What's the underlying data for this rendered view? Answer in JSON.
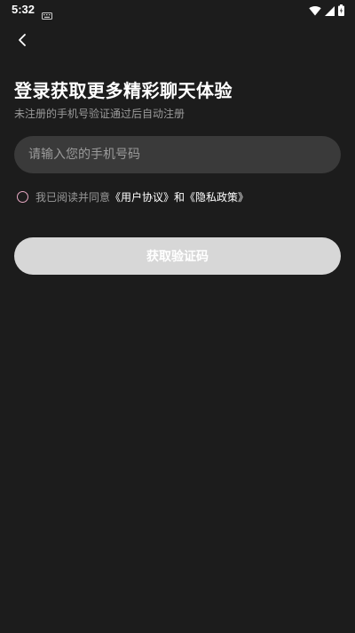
{
  "status_bar": {
    "time": "5:32",
    "icons": [
      "keyboard-icon",
      "wifi-icon",
      "signal-icon",
      "battery-icon"
    ]
  },
  "header": {
    "back_icon": "chevron-left-icon"
  },
  "login": {
    "title": "登录获取更多精彩聊天体验",
    "subtitle": "未注册的手机号验证通过后自动注册",
    "phone_placeholder": "请输入您的手机号码",
    "agreement": {
      "prefix": "我已阅读并同意",
      "user_agreement": "《用户协议》",
      "and": "和",
      "privacy_policy": "《隐私政策》",
      "checked": false
    },
    "get_code_label": "获取验证码"
  },
  "colors": {
    "background": "#1c1c1c",
    "input_bg": "#3a3a3a",
    "button_bg": "#d7d7d7",
    "radio_border": "#e8a9c4",
    "muted_text": "#9a9a9a"
  }
}
